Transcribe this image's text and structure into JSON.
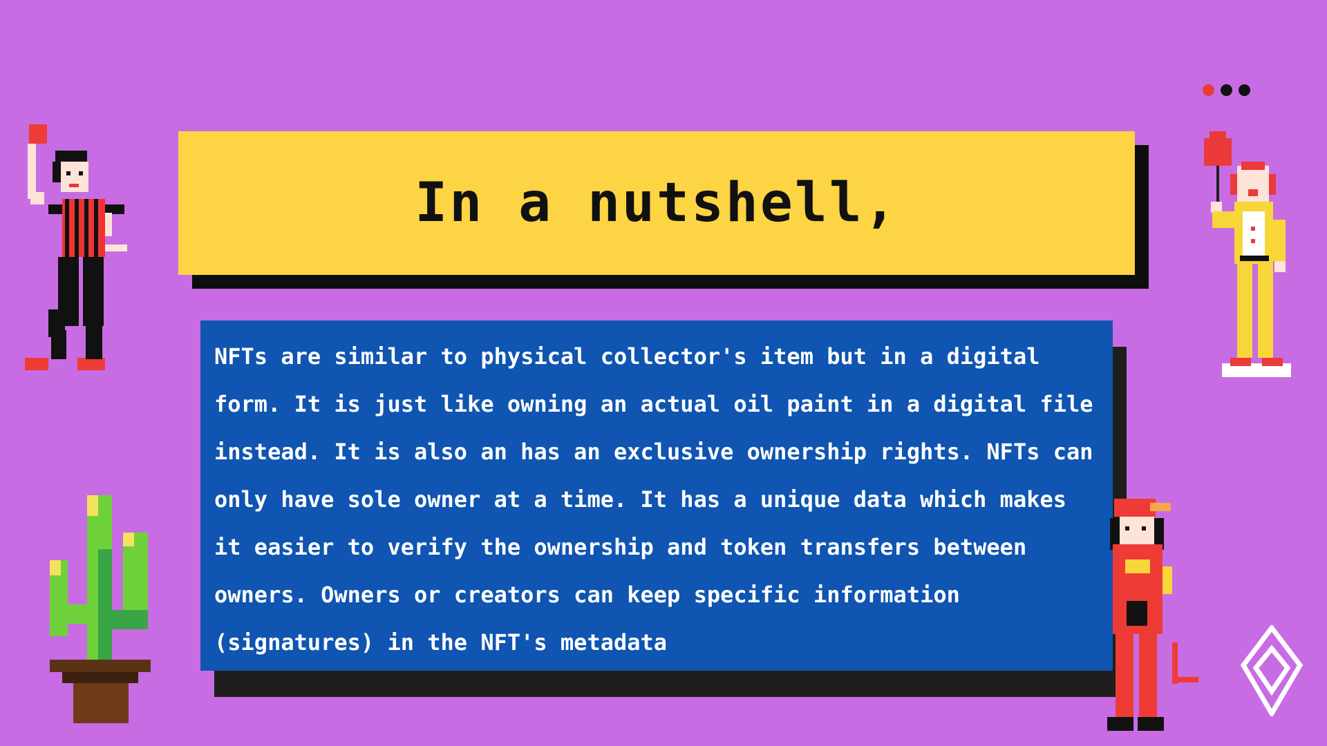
{
  "slide": {
    "title": "In a nutshell,",
    "body_lines": [
      "NFTs are similar to physical collector's item but in a digital",
      "form. It is just like owning an actual oil paint in a digital file",
      "instead. It is also an has an exclusive ownership rights. NFTs can",
      "only have sole owner at a time. It has a unique data which makes",
      "it easier to verify the ownership and token transfers between",
      "owners. Owners or creators can keep specific information",
      "(signatures) in the NFT's metadata"
    ]
  },
  "colors": {
    "background": "#c86ce3",
    "title_box": "#fdd443",
    "body_box": "#0f55b1",
    "shadow": "#0d0d0d",
    "dot_accent": "#ea3a3a",
    "dot_dark": "#111111"
  },
  "decorations": [
    "referee-character",
    "clown-with-balloon-character",
    "cactus-plant",
    "red-devil-character",
    "diamond-logo-icon",
    "window-dots"
  ]
}
